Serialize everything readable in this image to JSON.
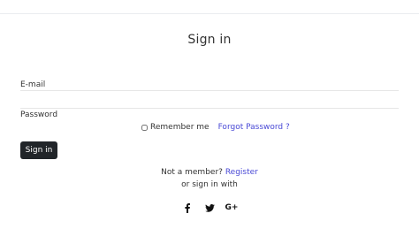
{
  "page": {
    "title": "Sign in"
  },
  "form": {
    "email_label": "E-mail",
    "email_value": "",
    "email_placeholder": "",
    "password_label": "Password",
    "password_value": "",
    "password_placeholder": "",
    "remember_label": "Remember me",
    "remember_checked": false,
    "forgot_label": "Forgot Password ?",
    "submit_label": "Sign in"
  },
  "footer": {
    "member_prompt": "Not a member?",
    "register_label": "Register",
    "alt_signin": "or sign in with"
  },
  "social": {
    "icons": [
      "facebook-icon",
      "twitter-icon",
      "google-plus-icon"
    ],
    "google_plus_label": "G+"
  },
  "colors": {
    "link": "#4a4ad6",
    "button_bg": "#212529",
    "button_text": "#ffffff"
  }
}
